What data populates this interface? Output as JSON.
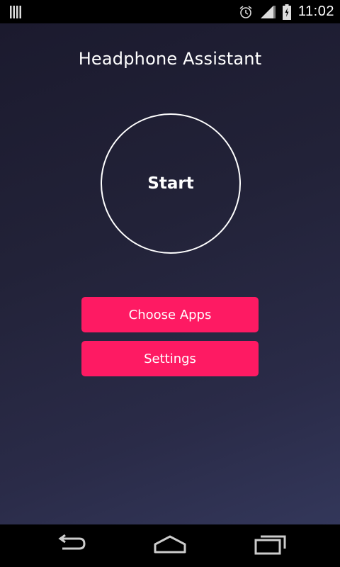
{
  "status_bar": {
    "time": "11:02",
    "icons": [
      "notification-bars-icon",
      "alarm-icon",
      "signal-icon",
      "battery-icon"
    ]
  },
  "app": {
    "title": "Headphone Assistant",
    "start_label": "Start",
    "choose_apps_label": "Choose Apps",
    "settings_label": "Settings"
  },
  "nav_bar": {
    "icons": [
      "back-icon",
      "home-icon",
      "recent-apps-icon"
    ]
  },
  "colors": {
    "accent": "#fe1a63",
    "background_top": "#1b1a2e",
    "background_bottom": "#33375a",
    "text": "#ffffff"
  }
}
